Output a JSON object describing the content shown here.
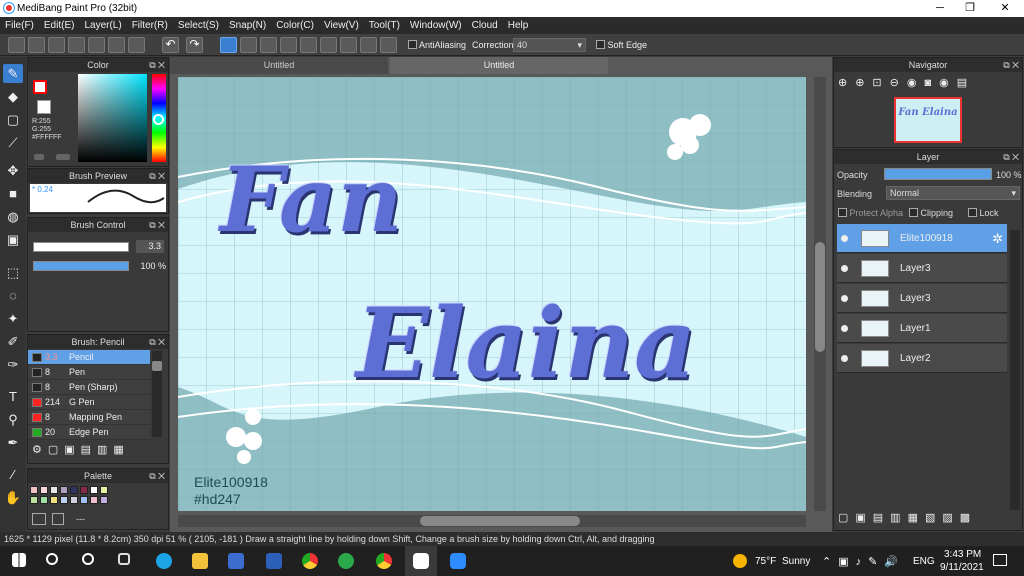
{
  "title_bar": {
    "title": "MediBang Paint Pro (32bit)",
    "minimize": "─",
    "maximize": "❐",
    "close": "✕"
  },
  "menu": [
    "File(F)",
    "Edit(E)",
    "Layer(L)",
    "Filter(R)",
    "Select(S)",
    "Snap(N)",
    "Color(C)",
    "View(V)",
    "Tool(T)",
    "Window(W)",
    "Cloud",
    "Help"
  ],
  "toolbar": {
    "antialiasing_label": "AntiAliasing",
    "correction_label": "Correction",
    "correction_value": "40",
    "soft_edge_label": "Soft Edge"
  },
  "color_panel": {
    "title": "Color",
    "r": "R:255",
    "g": "G:255",
    "hex": "#FFFFFF",
    "primary_color": "#ff0000",
    "secondary_color": "#ffffff"
  },
  "brush_preview": {
    "title": "Brush Preview",
    "size": "0.24"
  },
  "brush_control": {
    "title": "Brush Control",
    "size_value": "3.3",
    "opacity_value": "100 %"
  },
  "brush_list": {
    "title": "Brush: Pencil",
    "items": [
      {
        "size": "3.3",
        "name": "Pencil",
        "color": "#222222",
        "selected": true
      },
      {
        "size": "8",
        "name": "Pen",
        "color": "#222222",
        "selected": false
      },
      {
        "size": "8",
        "name": "Pen (Sharp)",
        "color": "#222222",
        "selected": false
      },
      {
        "size": "214",
        "name": "G Pen",
        "color": "#ff2222",
        "selected": false
      },
      {
        "size": "8",
        "name": "Mapping Pen",
        "color": "#ff2222",
        "selected": false
      },
      {
        "size": "20",
        "name": "Edge Pen",
        "color": "#22aa22",
        "selected": false
      }
    ]
  },
  "palette": {
    "title": "Palette",
    "extra": "---",
    "colors": [
      "#f2c0c0",
      "#f5d7d7",
      "#e8e8e8",
      "#b0a0c0",
      "#333366",
      "#8a2a4a",
      "#ffffff",
      "#e8f0a0",
      "#c0e0a0",
      "#a0e0a0",
      "#f0e080",
      "#c0d0f0",
      "#d0d0e0",
      "#a0c0f0",
      "#f0c0d0",
      "#c0b0e0"
    ]
  },
  "canvas": {
    "tabs": [
      "Untitled",
      "Untitled"
    ],
    "title_line1": "Fan",
    "title_line2": "Elaina",
    "watermark_line1": "Elite100918",
    "watermark_line2": "#hd247",
    "background_color": "#8fbfc4"
  },
  "navigator": {
    "title": "Navigator",
    "thumb_text": "Fan Elaina"
  },
  "layer_panel": {
    "title": "Layer",
    "opacity_label": "Opacity",
    "opacity_value": "100 %",
    "blending_label": "Blending",
    "blending_value": "Normal",
    "protect_alpha_label": "Protect Alpha",
    "clipping_label": "Clipping",
    "lock_label": "Lock",
    "layers": [
      {
        "name": "Elite100918",
        "selected": true
      },
      {
        "name": "Layer3",
        "selected": false
      },
      {
        "name": "Layer3",
        "selected": false
      },
      {
        "name": "Layer1",
        "selected": false
      },
      {
        "name": "Layer2",
        "selected": false
      }
    ]
  },
  "status_bar": {
    "text": "1625 * 1129 pixel  (11.8 * 8.2cm)  350 dpi  51 %  ( 2105, -181 )  Draw a straight line by holding down Shift, Change a brush size by holding down Ctrl, Alt, and dragging"
  },
  "taskbar": {
    "weather_temp": "75°F",
    "weather_desc": "Sunny",
    "language": "ENG",
    "time": "3:43 PM",
    "date": "9/11/2021"
  }
}
